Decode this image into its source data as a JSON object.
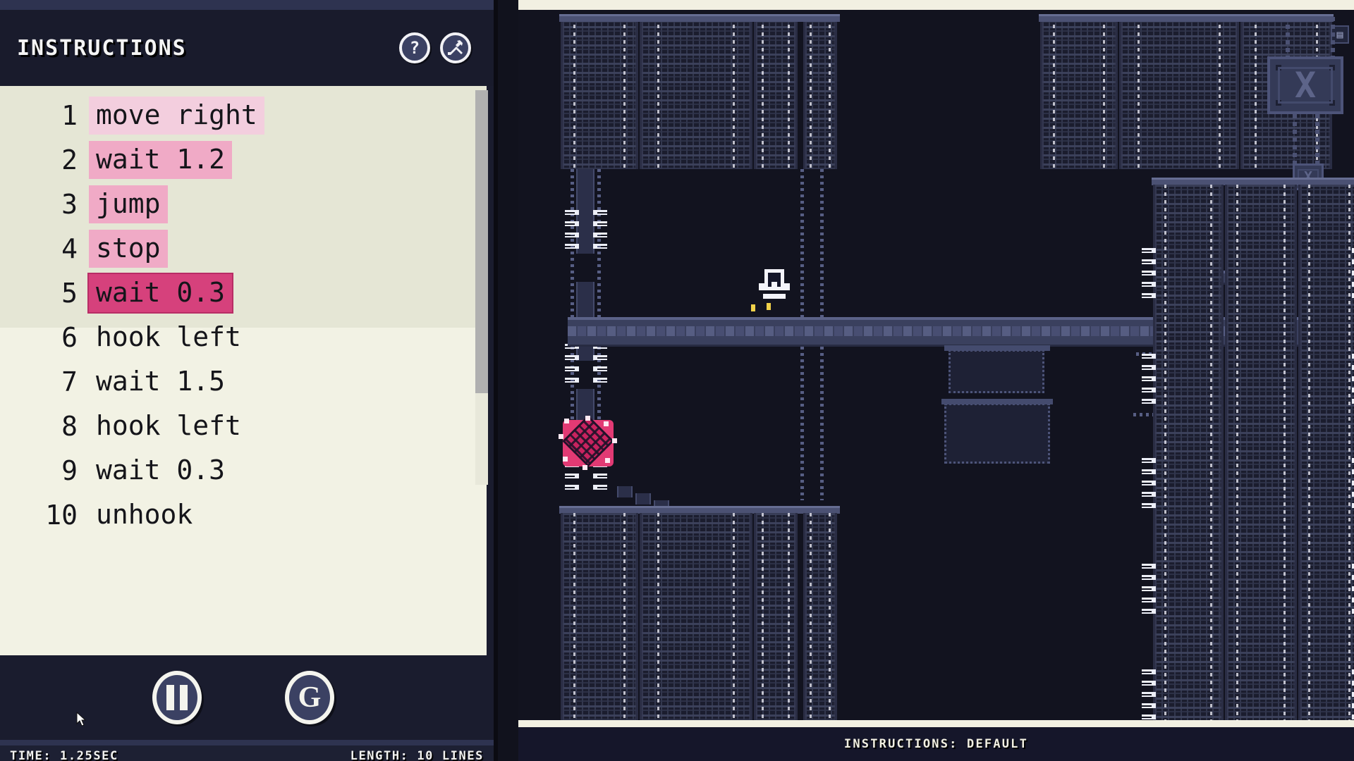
{
  "panel": {
    "title": "INSTRUCTIONS",
    "header_buttons": [
      {
        "name": "help-button",
        "icon": "question-mark-icon",
        "label": "?"
      },
      {
        "name": "tools-button",
        "icon": "wrench-screwdriver-icon",
        "label": ""
      }
    ],
    "code_lines": [
      {
        "num": "1",
        "text": "move right",
        "highlight": "hl1"
      },
      {
        "num": "2",
        "text": "wait 1.2",
        "highlight": "hl2"
      },
      {
        "num": "3",
        "text": "jump",
        "highlight": "hl3"
      },
      {
        "num": "4",
        "text": "stop",
        "highlight": "hl4"
      },
      {
        "num": "5",
        "text": "wait 0.3",
        "highlight": "hl5"
      },
      {
        "num": "6",
        "text": "hook left",
        "highlight": ""
      },
      {
        "num": "7",
        "text": "wait 1.5",
        "highlight": ""
      },
      {
        "num": "8",
        "text": "hook left",
        "highlight": ""
      },
      {
        "num": "9",
        "text": "wait 0.3",
        "highlight": ""
      },
      {
        "num": "10",
        "text": "unhook",
        "highlight": ""
      }
    ],
    "controls": [
      {
        "name": "pause-button",
        "icon": "pause-icon",
        "label": ""
      },
      {
        "name": "gravity-button",
        "icon": "g-letter-icon",
        "label": "G"
      }
    ],
    "status": {
      "time_label": "TIME: 1.25SEC",
      "length_label": "LENGTH: 10 LINES"
    }
  },
  "game": {
    "status_bar": "INSTRUCTIONS:  DEFAULT",
    "player": {
      "name": "player-character",
      "state": "hooked"
    },
    "crates": [
      {
        "name": "crate-large-x",
        "glyph": "X"
      },
      {
        "name": "crate-small-x",
        "glyph": "X"
      }
    ],
    "bot": {
      "name": "bot-marker",
      "glyph": ""
    }
  },
  "colors": {
    "panel_bg": "#1a1c2e",
    "code_bg": "#f2f2e4",
    "code_bg_shaded": "#e5e6d5",
    "highlight_light": "#f3cede",
    "highlight_mid": "#f0aac6",
    "highlight_active": "#d6417c",
    "world_bg": "#12131f",
    "frame": "#f2f0e2",
    "player_pink": "#e23a74",
    "accent_text": "#f4f4f4"
  }
}
